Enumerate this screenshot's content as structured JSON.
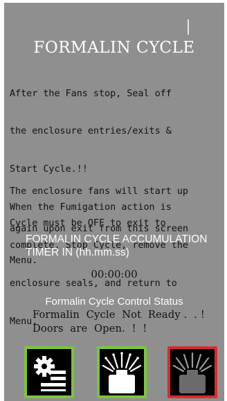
{
  "title": "FORMALIN CYCLE",
  "instructions": {
    "p1_lines": [
      "After the Fans stop, Seal off",
      "the enclosure entries/exits &",
      "Start Cycle.!!",
      "When the Fumigation action is",
      "complete, Stop Cycle, remove the",
      "enclosure seals, and return to",
      "Menu."
    ],
    "p2_lines": [
      "The enclosure fans will start up",
      "again upon exit from this screen"
    ],
    "p3_lines": [
      "Cycle must be OFF to exit to",
      "Menu."
    ]
  },
  "timer": {
    "label_line1": "FORMALIN CYCLE ACCUMULATION",
    "label_line2": "TIMER IN (hh.mm.ss)",
    "value": "00:00:00"
  },
  "status": {
    "label": "Formalin Cycle Control Status",
    "line1": "Formalin  Cycle  Not  Ready .  . !",
    "line2": "Doors  are  Open.  !  !"
  },
  "buttons": {
    "menu": {
      "icon": "gear-menu-icon",
      "border_color": "#7bc63b"
    },
    "start": {
      "icon": "fumigator-on-icon",
      "border_color": "#7bc63b"
    },
    "stop": {
      "icon": "fumigator-off-icon",
      "border_color": "#d62d2d"
    }
  },
  "colors": {
    "background": "#8f8f8f",
    "title": "#ffffff",
    "text": "#111111"
  }
}
